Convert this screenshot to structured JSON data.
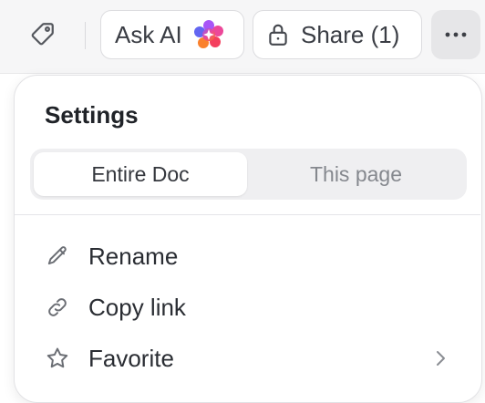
{
  "toolbar": {
    "ask_ai_label": "Ask AI",
    "share_label": "Share (1)",
    "icons": {
      "tag": "tag-icon",
      "sparkle": "ai-sparkle-icon",
      "lock": "lock-icon",
      "more": "more-horizontal-icon"
    }
  },
  "menu": {
    "title": "Settings",
    "scope_tabs": [
      {
        "label": "Entire Doc",
        "selected": true
      },
      {
        "label": "This page",
        "selected": false
      }
    ],
    "items": [
      {
        "label": "Rename",
        "icon": "pencil-icon"
      },
      {
        "label": "Copy link",
        "icon": "link-icon"
      },
      {
        "label": "Favorite",
        "icon": "star-icon",
        "has_submenu": true
      }
    ]
  },
  "colors": {
    "toolbar_bg": "#f6f6f7",
    "text": "#2a2e34",
    "muted_text": "#85888e",
    "segment_bg": "#efeff1"
  }
}
